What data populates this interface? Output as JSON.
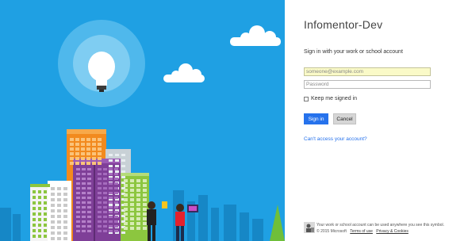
{
  "illustration": {
    "background_color": "#1fa0e3",
    "icon": "lightbulb-icon"
  },
  "login": {
    "app_title": "Infomentor-Dev",
    "subtitle": "Sign in with your work or school account",
    "email_placeholder": "someone@example.com",
    "password_placeholder": "Password",
    "keep_signed_in_label": "Keep me signed in",
    "keep_signed_in_checked": false,
    "signin_button_label": "Sign in",
    "cancel_button_label": "Cancel",
    "cant_access_link": "Can't access your account?",
    "accent_color": "#2672ec"
  },
  "footer": {
    "message": "Your work or school account can be used anywhere you see this symbol.",
    "copyright": "© 2015 Microsoft",
    "terms_link": "Terms of use",
    "privacy_link": "Privacy & Cookies"
  }
}
